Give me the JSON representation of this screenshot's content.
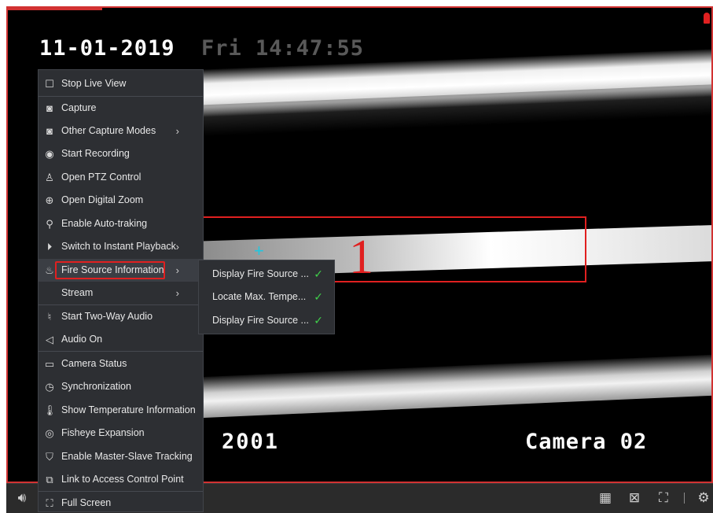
{
  "video": {
    "osd_date": "11-01-2019",
    "osd_day_time": "Fri 14:47:55",
    "osd_channel_number": "2001",
    "osd_camera_name": "Camera 02",
    "region_label": "1",
    "colors": {
      "alarm_red": "#e02020",
      "check_green": "#3fd14a",
      "menu_bg": "#2d2f33"
    }
  },
  "context_menu": {
    "items": [
      {
        "label": "Stop Live View",
        "icon": "square-icon"
      },
      {
        "label": "Capture",
        "icon": "camera-icon"
      },
      {
        "label": "Other Capture Modes",
        "icon": "camera-icon",
        "submenu": true
      },
      {
        "label": "Start Recording",
        "icon": "record-icon"
      },
      {
        "label": "Open PTZ Control",
        "icon": "ptz-icon"
      },
      {
        "label": "Open Digital Zoom",
        "icon": "zoom-icon"
      },
      {
        "label": "Enable Auto-traking",
        "icon": "search-icon"
      },
      {
        "label": "Switch to Instant Playback",
        "icon": "playback-icon",
        "submenu": true
      },
      {
        "label": "Fire Source Information",
        "icon": "fire-icon",
        "submenu": true,
        "highlighted": true
      },
      {
        "label": "Stream",
        "icon": "",
        "submenu": true
      },
      {
        "label": "Start Two-Way Audio",
        "icon": "microphone-icon"
      },
      {
        "label": "Audio On",
        "icon": "speaker-mute-icon"
      },
      {
        "label": "Camera Status",
        "icon": "camera-status-icon"
      },
      {
        "label": "Synchronization",
        "icon": "clock-icon"
      },
      {
        "label": "Show Temperature Information",
        "icon": "thermometer-icon"
      },
      {
        "label": "Fisheye Expansion",
        "icon": "fisheye-icon"
      },
      {
        "label": "Enable Master-Slave Tracking",
        "icon": "tracking-icon"
      },
      {
        "label": "Link to Access Control Point",
        "icon": "link-icon"
      },
      {
        "label": "Full Screen",
        "icon": "fullscreen-icon"
      }
    ]
  },
  "submenu": {
    "items": [
      {
        "label": "Display Fire Source ...",
        "checked": true
      },
      {
        "label": "Locate Max. Tempe...",
        "checked": true
      },
      {
        "label": "Display Fire Source ...",
        "checked": true
      }
    ]
  },
  "bottom_bar": {
    "icons": [
      "volume-icon",
      "layout-icon",
      "close-all-icon",
      "fullscreen-icon",
      "settings-icon"
    ]
  }
}
